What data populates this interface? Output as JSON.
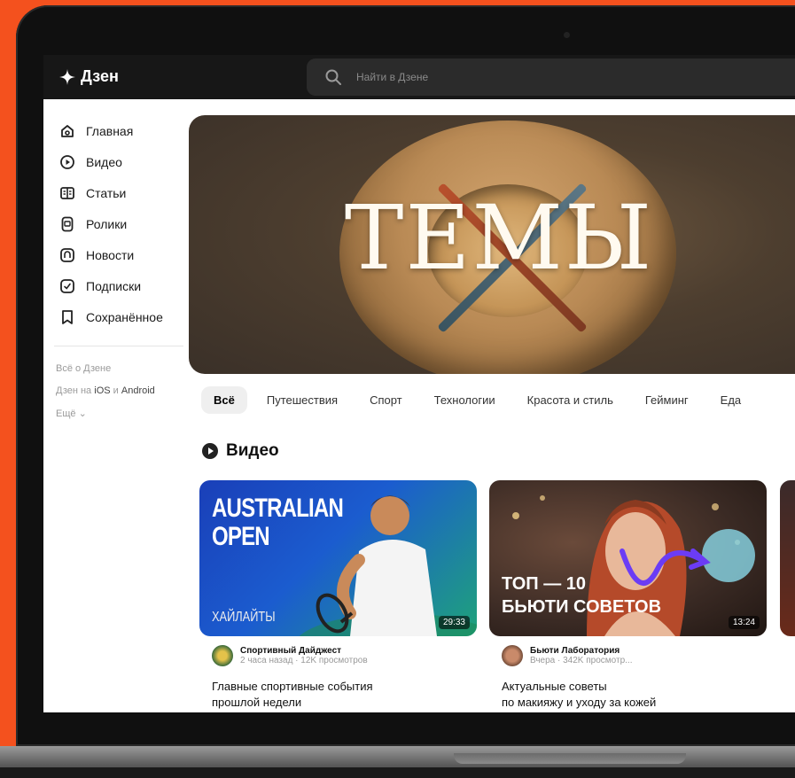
{
  "header": {
    "logo_text": "Дзен",
    "search_placeholder": "Найти в Дзене"
  },
  "sidebar": {
    "items": [
      {
        "label": "Главная",
        "icon": "home-icon"
      },
      {
        "label": "Видео",
        "icon": "video-icon"
      },
      {
        "label": "Статьи",
        "icon": "articles-icon"
      },
      {
        "label": "Ролики",
        "icon": "shorts-icon"
      },
      {
        "label": "Новости",
        "icon": "news-icon"
      },
      {
        "label": "Подписки",
        "icon": "subscriptions-icon"
      },
      {
        "label": "Сохранённое",
        "icon": "bookmark-icon"
      }
    ],
    "footer": {
      "about": "Всё о Дзене",
      "apps_prefix": "Дзен на",
      "ios": "iOS",
      "and": "и",
      "android": "Android",
      "more": "Ещё"
    }
  },
  "banner": {
    "title": "ТЕМЫ"
  },
  "tabs": [
    "Всё",
    "Путешествия",
    "Спорт",
    "Технологии",
    "Красота и стиль",
    "Гейминг",
    "Еда"
  ],
  "section": {
    "title": "Видео"
  },
  "videos": [
    {
      "thumb_title_line1": "AUSTRALIAN",
      "thumb_title_line2": "OPEN",
      "thumb_subtitle": "ХАЙЛАЙТЫ",
      "duration": "29:33",
      "channel": "Спортивный Дайджест",
      "meta": "2 часа назад · 12K просмотров",
      "title_line1": "Главные спортивные события",
      "title_line2": "прошлой недели"
    },
    {
      "thumb_title_line1": "ТОП — 10",
      "thumb_title_line2": "БЬЮТИ СОВЕТОВ",
      "duration": "13:24",
      "channel": "Бьюти Лаборатория",
      "meta": "Вчера · 342K просмотр...",
      "title_line1": "Актуальные советы",
      "title_line2": "по макияжу и уходу за кожей"
    }
  ],
  "colors": {
    "background": "#f4511e",
    "topbar": "#171717",
    "accent_purple": "#6b3cf5",
    "tennis_blue": "#1a3fb8",
    "tennis_green": "#1fa37a"
  }
}
